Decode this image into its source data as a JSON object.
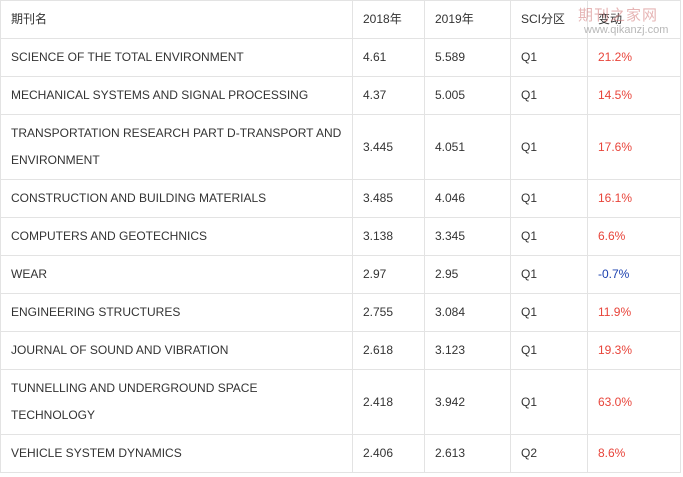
{
  "table": {
    "headers": {
      "name": "期刊名",
      "y2018": "2018年",
      "y2019": "2019年",
      "sci": "SCI分区",
      "change": "变动"
    },
    "rows": [
      {
        "name": "SCIENCE OF THE TOTAL  ENVIRONMENT",
        "y2018": "4.61",
        "y2019": "5.589",
        "sci": "Q1",
        "change": "21.2%"
      },
      {
        "name": "MECHANICAL SYSTEMS AND SIGNAL PROCESSING",
        "y2018": "4.37",
        "y2019": "5.005",
        "sci": "Q1",
        "change": "14.5%"
      },
      {
        "name": "TRANSPORTATION RESEARCH  PART D-TRANSPORT AND ENVIRONMENT",
        "y2018": "3.445",
        "y2019": "4.051",
        "sci": "Q1",
        "change": "17.6%"
      },
      {
        "name": "CONSTRUCTION AND BUILDING MATERIALS",
        "y2018": "3.485",
        "y2019": "4.046",
        "sci": "Q1",
        "change": "16.1%"
      },
      {
        "name": "COMPUTERS AND  GEOTECHNICS",
        "y2018": "3.138",
        "y2019": "3.345",
        "sci": "Q1",
        "change": "6.6%"
      },
      {
        "name": "WEAR",
        "y2018": "2.97",
        "y2019": "2.95",
        "sci": "Q1",
        "change": "-0.7%"
      },
      {
        "name": "ENGINEERING STRUCTURES",
        "y2018": "2.755",
        "y2019": "3.084",
        "sci": "Q1",
        "change": "11.9%"
      },
      {
        "name": "JOURNAL OF SOUND AND  VIBRATION",
        "y2018": "2.618",
        "y2019": "3.123",
        "sci": "Q1",
        "change": "19.3%"
      },
      {
        "name": "TUNNELLING AND  UNDERGROUND SPACE TECHNOLOGY",
        "y2018": "2.418",
        "y2019": "3.942",
        "sci": "Q1",
        "change": "63.0%"
      },
      {
        "name": "VEHICLE SYSTEM DYNAMICS",
        "y2018": "2.406",
        "y2019": "2.613",
        "sci": "Q2",
        "change": "8.6%"
      }
    ]
  },
  "colors": {
    "increase": "#e8443a",
    "decrease": "#1a3fae",
    "border": "#e3e3e3"
  },
  "watermark": {
    "cn": "期刊之家网",
    "url": "www.qikanzj.com"
  }
}
